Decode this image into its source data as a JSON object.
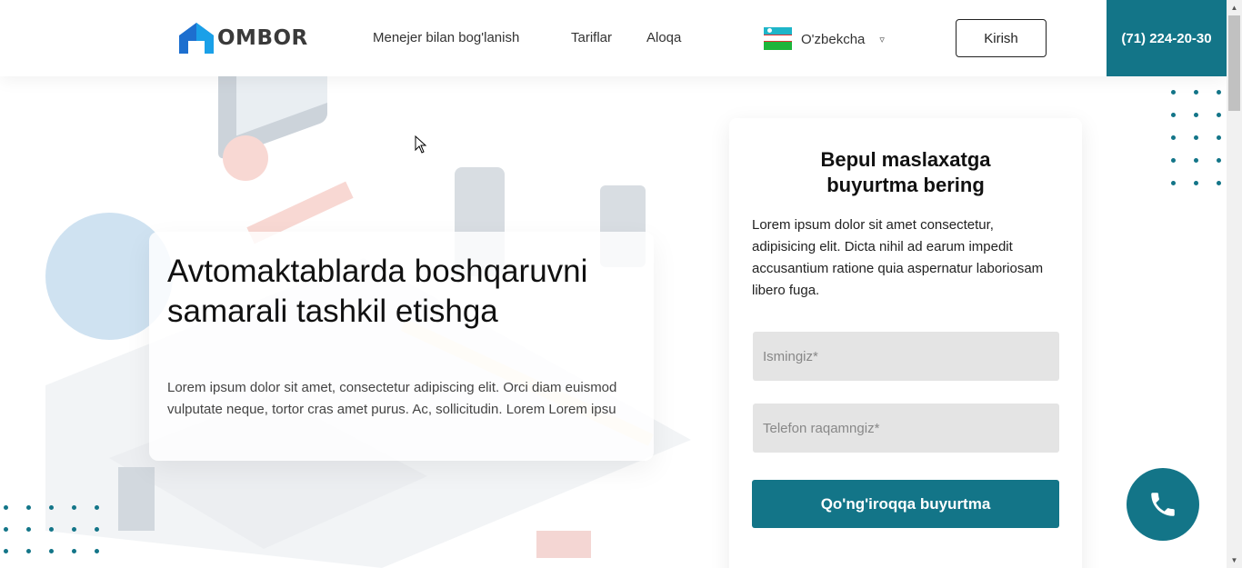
{
  "header": {
    "logo_text": "OMBOR",
    "nav": [
      "Menejer bilan bog'lanish",
      "Tariflar",
      "Aloqa"
    ],
    "language": "O'zbekcha",
    "login_label": "Kirish",
    "phone": "(71) 224-20-30"
  },
  "hero": {
    "title_line1": "Avtomaktablarda boshqaruvni",
    "title_line2": "samarali tashkil etishga",
    "text": "Lorem ipsum dolor sit amet, consectetur adipiscing elit. Orci diam euismod vulputate neque, tortor cras amet purus. Ac, sollicitudin. Lorem Lorem ipsu"
  },
  "form": {
    "title": "Bepul maslaxatga buyurtma bering",
    "description": "Lorem ipsum dolor sit amet consectetur, adipisicing elit. Dicta nihil ad earum impedit accusantium ratione quia aspernatur laboriosam libero fuga.",
    "name_placeholder": "Ismingiz*",
    "phone_placeholder": "Telefon raqamngiz*",
    "submit_label": "Qo'ng'iroqqa buyurtma"
  },
  "colors": {
    "accent": "#137588",
    "input_bg": "#e4e4e4",
    "text": "#111111"
  },
  "icons": [
    "logo-house-icon",
    "chevron-down-icon",
    "phone-icon",
    "cursor-icon"
  ]
}
